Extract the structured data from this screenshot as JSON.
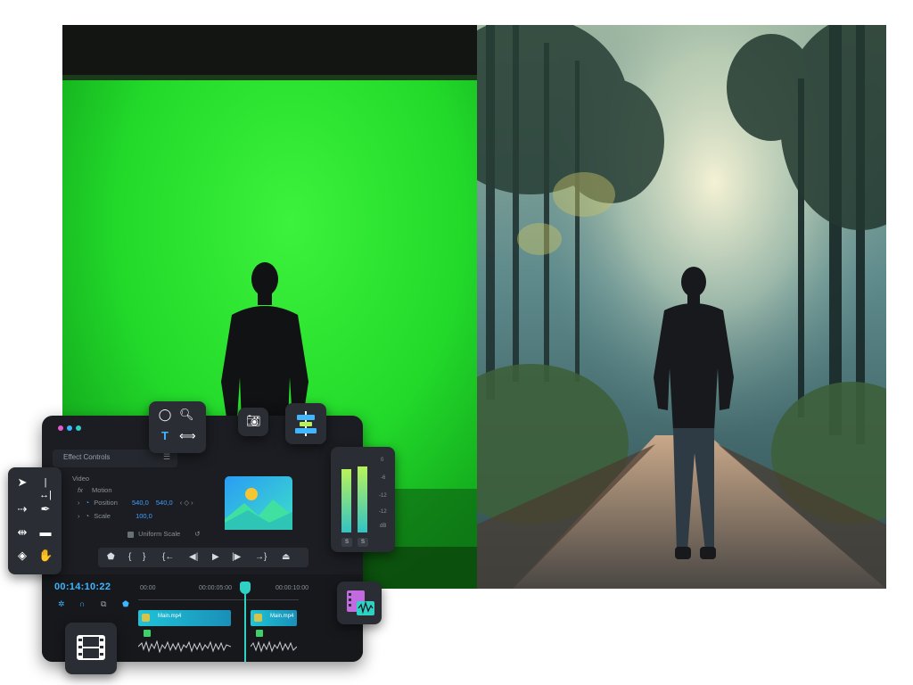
{
  "editor": {
    "panel_tab": "Effect Controls",
    "section_video": "Video",
    "section_motion": "Motion",
    "position_label": "Position",
    "position_x": "540,0",
    "position_y": "540,0",
    "scale_label": "Scale",
    "scale_value": "100,0",
    "uniform_scale_label": "Uniform Scale",
    "uniform_scale_checked": true,
    "fx_label": "fx",
    "timecode": "00:14:10:22",
    "ruler_times": [
      "00:00",
      "00:00:05:00",
      "00:00:10:00"
    ],
    "clips": [
      {
        "label": "Main.mp4"
      },
      {
        "label": "Main.mp4"
      }
    ]
  },
  "meter": {
    "labels": [
      "0",
      "-6",
      "-12",
      "-12",
      "dB"
    ],
    "solo_labels": [
      "S",
      "S"
    ],
    "levels": [
      0.82,
      0.86
    ]
  },
  "icons": {
    "tools": [
      "selection-tool-icon",
      "ripple-edit-icon",
      "track-select-icon",
      "pen-tool-icon",
      "slip-tool-icon",
      "rectangle-tool-icon",
      "razor-tool-icon",
      "hand-tool-icon"
    ],
    "top_tools": [
      "ellipse-tool-icon",
      "zoom-tool-icon",
      "type-tool-icon",
      "rate-stretch-icon"
    ],
    "camera": "camera-icon",
    "align": "align-center-icon",
    "media": "media-clip-icon",
    "film": "film-icon"
  },
  "colors": {
    "accent": "#3fb6ff",
    "green_screen": "#22d92a",
    "clip": "#1fc3d8",
    "playhead": "#2fd1c4"
  }
}
